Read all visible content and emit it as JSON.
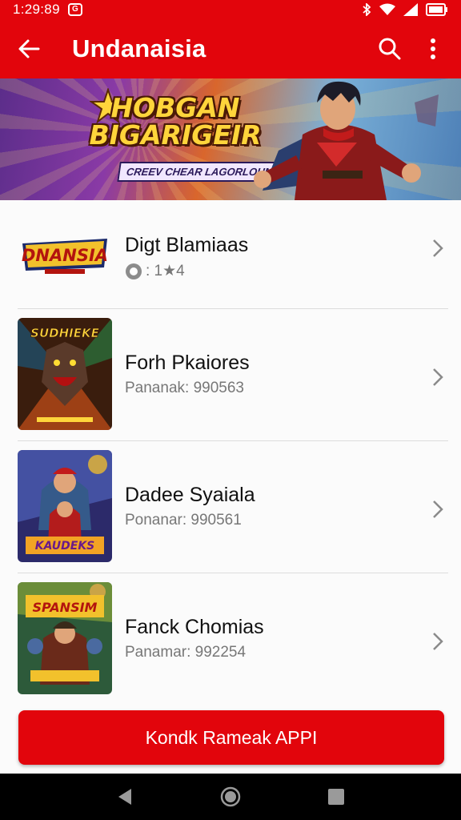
{
  "status_bar": {
    "time": "1:29:89",
    "notif_badge": "G"
  },
  "app_bar": {
    "title": "Undanaisia"
  },
  "banner": {
    "title_line1": "HOBGAN",
    "title_line2": "BIGARIGEIR",
    "tagline": "CREEV CHEAR LAGORLOUN"
  },
  "items": [
    {
      "title": "Digt Blamiaas",
      "subtitle": ": 1★4",
      "thumb_text": "DNANSIA"
    },
    {
      "title": "Forh Pkaiores",
      "subtitle": "Pananak: 990563",
      "thumb_text": "SUDHIEKE"
    },
    {
      "title": "Dadee Syaiala",
      "subtitle": "Ponanar: 990561",
      "thumb_text": "KAUDEKS"
    },
    {
      "title": "Fanck Chomias",
      "subtitle": "Panamar: 992254",
      "thumb_text": "SPANSIM"
    }
  ],
  "cta": {
    "label": "Kondk Rameak APPI"
  },
  "colors": {
    "primary": "#e2050c",
    "nav": "#000000"
  }
}
